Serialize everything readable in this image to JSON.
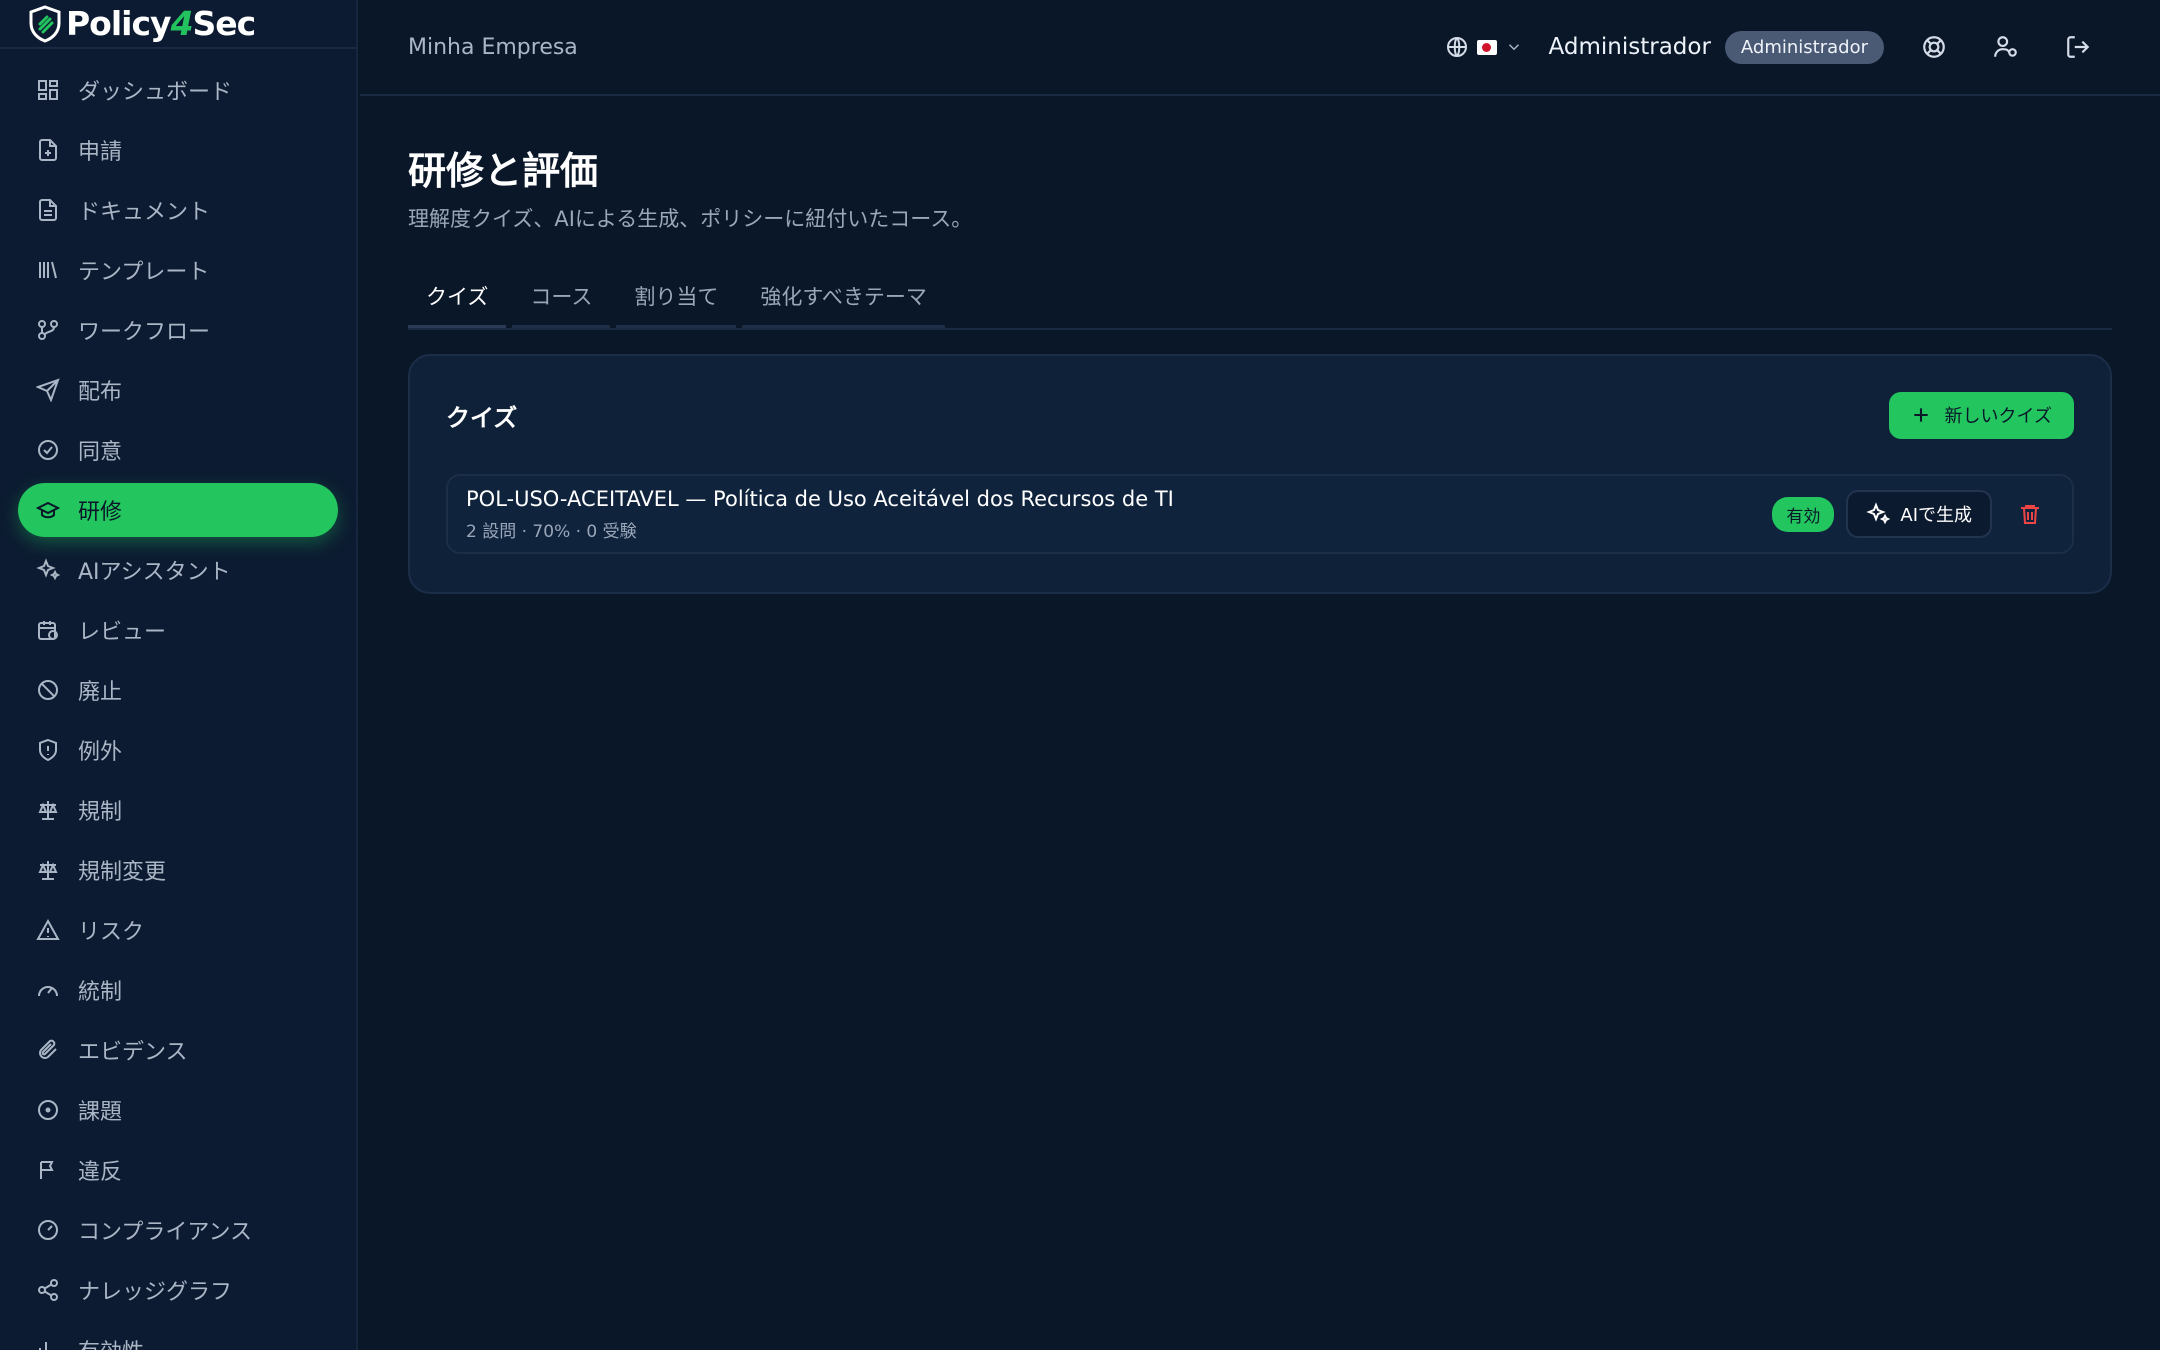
{
  "brand": {
    "name_left": "Policy",
    "name_four": "4",
    "name_right": "Sec",
    "accent": "#22c55e"
  },
  "sidebar": {
    "items": [
      {
        "label": "ダッシュボード",
        "icon": "dashboard-icon"
      },
      {
        "label": "申請",
        "icon": "file-plus-icon"
      },
      {
        "label": "ドキュメント",
        "icon": "document-icon"
      },
      {
        "label": "テンプレート",
        "icon": "library-icon"
      },
      {
        "label": "ワークフロー",
        "icon": "workflow-icon"
      },
      {
        "label": "配布",
        "icon": "send-icon"
      },
      {
        "label": "同意",
        "icon": "check-circle-icon"
      },
      {
        "label": "研修",
        "icon": "graduation-cap-icon",
        "active": true
      },
      {
        "label": "AIアシスタント",
        "icon": "sparkles-icon"
      },
      {
        "label": "レビュー",
        "icon": "calendar-clock-icon"
      },
      {
        "label": "廃止",
        "icon": "ban-icon"
      },
      {
        "label": "例外",
        "icon": "shield-alert-icon"
      },
      {
        "label": "規制",
        "icon": "scale-icon"
      },
      {
        "label": "規制変更",
        "icon": "scale-icon"
      },
      {
        "label": "リスク",
        "icon": "warning-icon"
      },
      {
        "label": "統制",
        "icon": "gauge-icon"
      },
      {
        "label": "エビデンス",
        "icon": "paperclip-icon"
      },
      {
        "label": "課題",
        "icon": "circle-dot-icon"
      },
      {
        "label": "違反",
        "icon": "flag-icon"
      },
      {
        "label": "コンプライアンス",
        "icon": "gauge-icon"
      },
      {
        "label": "ナレッジグラフ",
        "icon": "share-icon"
      },
      {
        "label": "有効性",
        "icon": "chart-icon"
      }
    ]
  },
  "header": {
    "org_name": "Minha Empresa",
    "user_name": "Administrador",
    "role": "Administrador"
  },
  "page": {
    "title": "研修と評価",
    "subtitle": "理解度クイズ、AIによる生成、ポリシーに紐付いたコース。",
    "tabs": [
      "クイズ",
      "コース",
      "割り当て",
      "強化すべきテーマ"
    ]
  },
  "quiz_card": {
    "title": "クイズ",
    "new_button": "新しいクイズ",
    "rows": [
      {
        "title": "POL-USO-ACEITAVEL — Política de Uso Aceitável dos Recursos de TI",
        "meta": "2 設問 · 70% · 0 受験",
        "status": "有効",
        "ai_button": "AIで生成"
      }
    ]
  }
}
